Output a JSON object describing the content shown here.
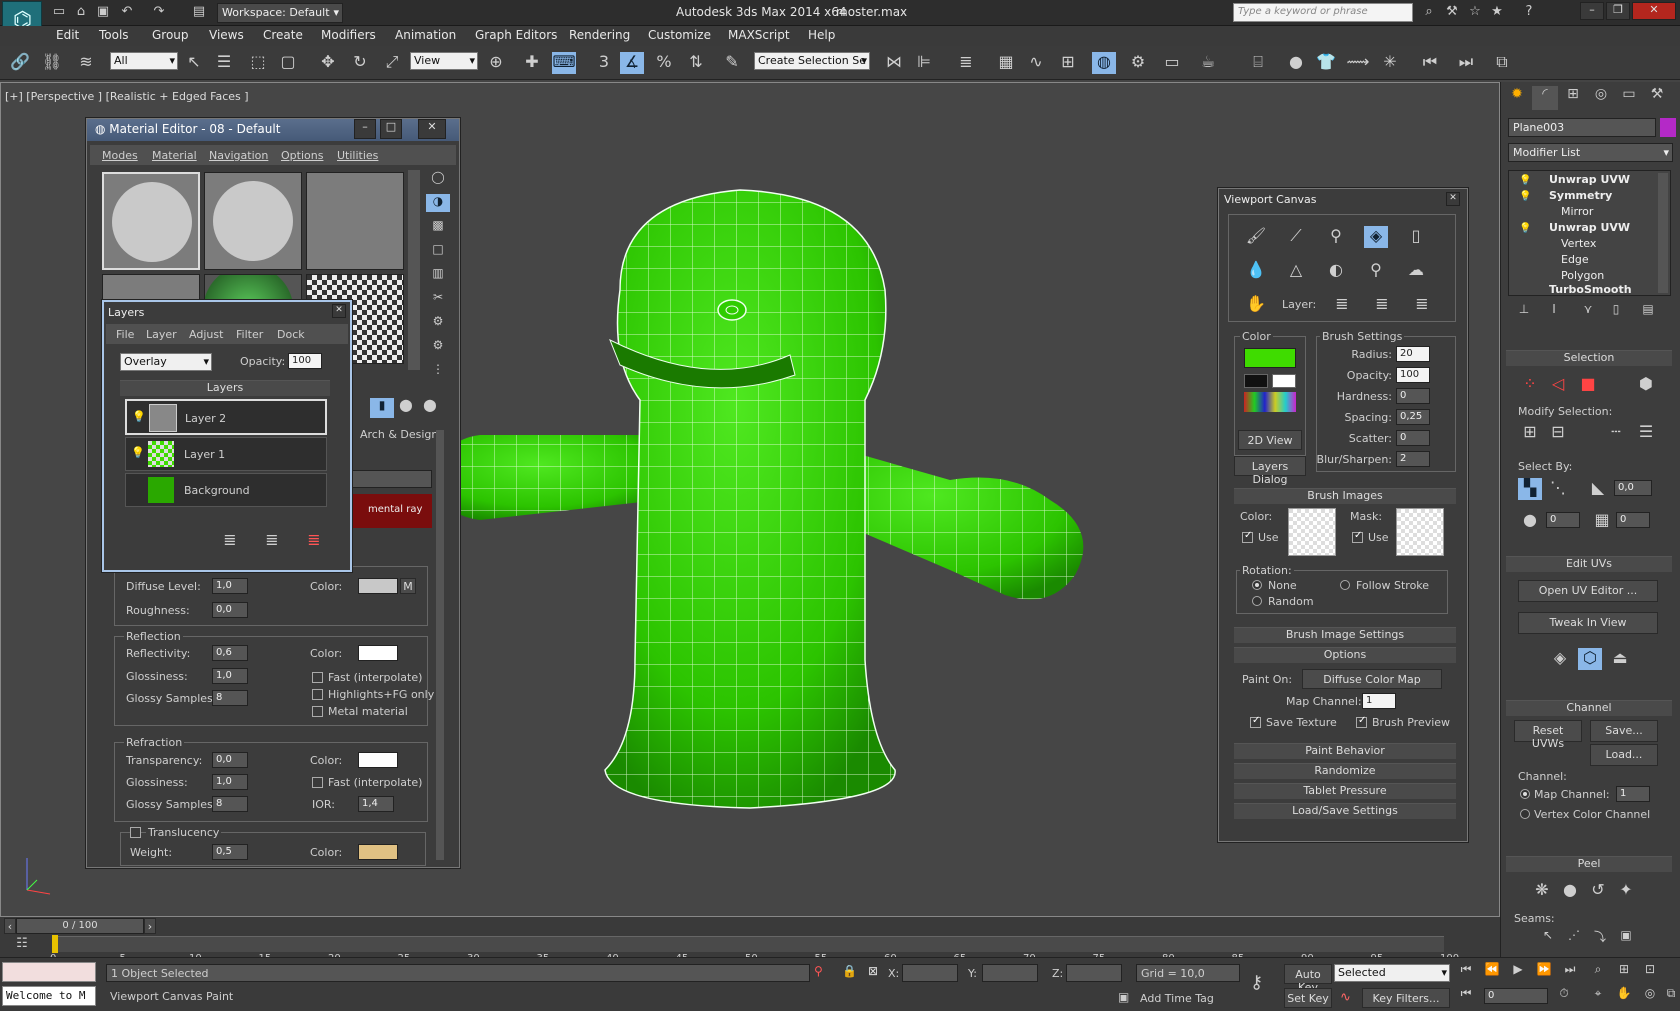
{
  "app": {
    "title": "Autodesk 3ds Max 2014 x64",
    "file": "moster.max",
    "workspace": "Workspace: Default",
    "search_placeholder": "Type a keyword or phrase"
  },
  "menu": [
    "Edit",
    "Tools",
    "Group",
    "Views",
    "Create",
    "Modifiers",
    "Animation",
    "Graph Editors",
    "Rendering",
    "Customize",
    "MAXScript",
    "Help"
  ],
  "toolbar": {
    "filter": "All",
    "ref_coord": "View",
    "selection_set": "Create Selection Se",
    "snap_label": "3"
  },
  "viewport": {
    "label": "[+] [Perspective ] [Realistic + Edged Faces ]"
  },
  "material_editor": {
    "title": "Material Editor - 08 - Default",
    "menu": [
      "Modes",
      "Material",
      "Navigation",
      "Options",
      "Utilities"
    ],
    "arch_label": "Arch & Design",
    "renderer_label": "mental ray",
    "diffuse": {
      "level_label": "Diffuse Level:",
      "level": "1,0",
      "rough_label": "Roughness:",
      "rough": "0,0",
      "color_label": "Color:",
      "m": "M"
    },
    "reflection": {
      "title": "Reflection",
      "refl_label": "Reflectivity:",
      "refl": "0,6",
      "gloss_label": "Glossiness:",
      "gloss": "1,0",
      "samples_label": "Glossy Samples:",
      "samples": "8",
      "color_label": "Color:",
      "fast": "Fast (interpolate)",
      "highlights": "Highlights+FG only",
      "metal": "Metal material"
    },
    "refraction": {
      "title": "Refraction",
      "trans_label": "Transparency:",
      "trans": "0,0",
      "gloss_label": "Glossiness:",
      "gloss": "1,0",
      "samples_label": "Glossy Samples:",
      "samples": "8",
      "color_label": "Color:",
      "fast": "Fast (interpolate)",
      "ior_label": "IOR:",
      "ior": "1,4"
    },
    "translucency": {
      "title": "Translucency",
      "weight_label": "Weight:",
      "weight": "0,5",
      "color_label": "Color:"
    }
  },
  "layers": {
    "title": "Layers",
    "menu": [
      "File",
      "Layer",
      "Adjust",
      "Filter",
      "Dock"
    ],
    "blend": "Overlay",
    "opacity_label": "Opacity:",
    "opacity": "100",
    "header": "Layers",
    "items": [
      {
        "name": "Layer 2"
      },
      {
        "name": "Layer 1"
      },
      {
        "name": "Background"
      }
    ]
  },
  "canvas": {
    "title": "Viewport Canvas",
    "layer_label": "Layer:",
    "color_label": "Color",
    "fg_color": "#3fdc00",
    "brush_settings": {
      "title": "Brush Settings",
      "rows": [
        {
          "label": "Radius:",
          "value": "20"
        },
        {
          "label": "Opacity:",
          "value": "100"
        },
        {
          "label": "Hardness:",
          "value": "0"
        },
        {
          "label": "Spacing:",
          "value": "0,25"
        },
        {
          "label": "Scatter:",
          "value": "0"
        },
        {
          "label": "Blur/Sharpen:",
          "value": "2"
        }
      ]
    },
    "view2d": "2D View",
    "layers_dialog": "Layers Dialog",
    "brush_images": {
      "title": "Brush Images",
      "color_label": "Color:",
      "mask_label": "Mask:",
      "use": "Use",
      "rotation_label": "Rotation:",
      "none": "None",
      "follow": "Follow Stroke",
      "random": "Random"
    },
    "brush_image_settings": "Brush Image Settings",
    "options": {
      "title": "Options",
      "paint_on_label": "Paint On:",
      "paint_on": "Diffuse Color Map",
      "map_channel_label": "Map Channel:",
      "map_channel": "1",
      "save_texture": "Save Texture",
      "brush_preview": "Brush Preview"
    },
    "rollups": [
      "Paint Behavior",
      "Randomize",
      "Tablet Pressure",
      "Load/Save Settings"
    ]
  },
  "command_panel": {
    "object_name": "Plane003",
    "modifier_list": "Modifier List",
    "stack": [
      {
        "name": "Unwrap UVW",
        "level": 0,
        "bold": true
      },
      {
        "name": "Symmetry",
        "level": 0,
        "bold": true
      },
      {
        "name": "Mirror",
        "level": 1,
        "bold": false
      },
      {
        "name": "Unwrap UVW",
        "level": 0,
        "bold": true
      },
      {
        "name": "Vertex",
        "level": 1,
        "bold": false
      },
      {
        "name": "Edge",
        "level": 1,
        "bold": false
      },
      {
        "name": "Polygon",
        "level": 1,
        "bold": false
      },
      {
        "name": "TurboSmooth",
        "level": 0,
        "bold": true
      }
    ],
    "selection": {
      "title": "Selection",
      "modify_label": "Modify Selection:",
      "select_by": "Select By:",
      "v1": "0,0",
      "v2": "0",
      "v3": "0"
    },
    "edit_uvs": {
      "title": "Edit UVs",
      "open": "Open UV Editor ...",
      "tweak": "Tweak In View"
    },
    "channel": {
      "title": "Channel",
      "reset": "Reset UVWs",
      "save": "Save...",
      "load": "Load...",
      "channel_label": "Channel:",
      "map_channel": "Map Channel:",
      "map_value": "1",
      "vertex_color": "Vertex Color Channel"
    },
    "peel": {
      "title": "Peel",
      "seams": "Seams:"
    }
  },
  "timeline": {
    "frame": "0 / 100",
    "ticks": [
      "0",
      "5",
      "10",
      "15",
      "20",
      "25",
      "30",
      "35",
      "40",
      "45",
      "50",
      "55",
      "60",
      "65",
      "70",
      "75",
      "80",
      "85",
      "90",
      "95",
      "100"
    ]
  },
  "status": {
    "welcome": "Welcome to M",
    "selected": "1 Object Selected",
    "prompt": "Viewport Canvas Paint",
    "x": "X:",
    "y": "Y:",
    "z": "Z:",
    "grid": "Grid = 10,0",
    "add_time_tag": "Add Time Tag",
    "auto_key": "Auto Key",
    "set_key": "Set Key",
    "key_mode": "Selected",
    "key_filters": "Key Filters...",
    "frame_value": "0"
  }
}
